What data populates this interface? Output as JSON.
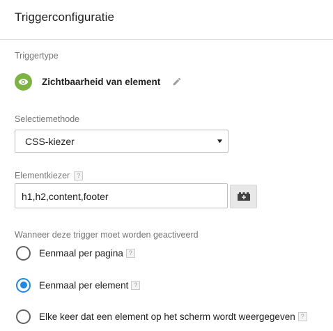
{
  "header": {
    "title": "Triggerconfiguratie"
  },
  "trigger_type": {
    "label": "Triggertype",
    "name": "Zichtbaarheid van element",
    "icon": "eye-icon",
    "icon_color": "#7cb342"
  },
  "selection_method": {
    "label": "Selectiemethode",
    "value": "CSS-kiezer"
  },
  "element_selector": {
    "label": "Elementkiezer",
    "help": "?",
    "value": "h1,h2,content,footer",
    "variable_button_icon": "add-variable-icon"
  },
  "firing": {
    "label": "Wanneer deze trigger moet worden geactiveerd",
    "options": [
      {
        "label": "Eenmaal per pagina",
        "help": "?",
        "checked": false
      },
      {
        "label": "Eenmaal per element",
        "help": "?",
        "checked": true
      },
      {
        "label": "Elke keer dat een element op het scherm wordt weergegeven",
        "help": "?",
        "checked": false
      }
    ],
    "accent_color": "#1e88e5"
  }
}
